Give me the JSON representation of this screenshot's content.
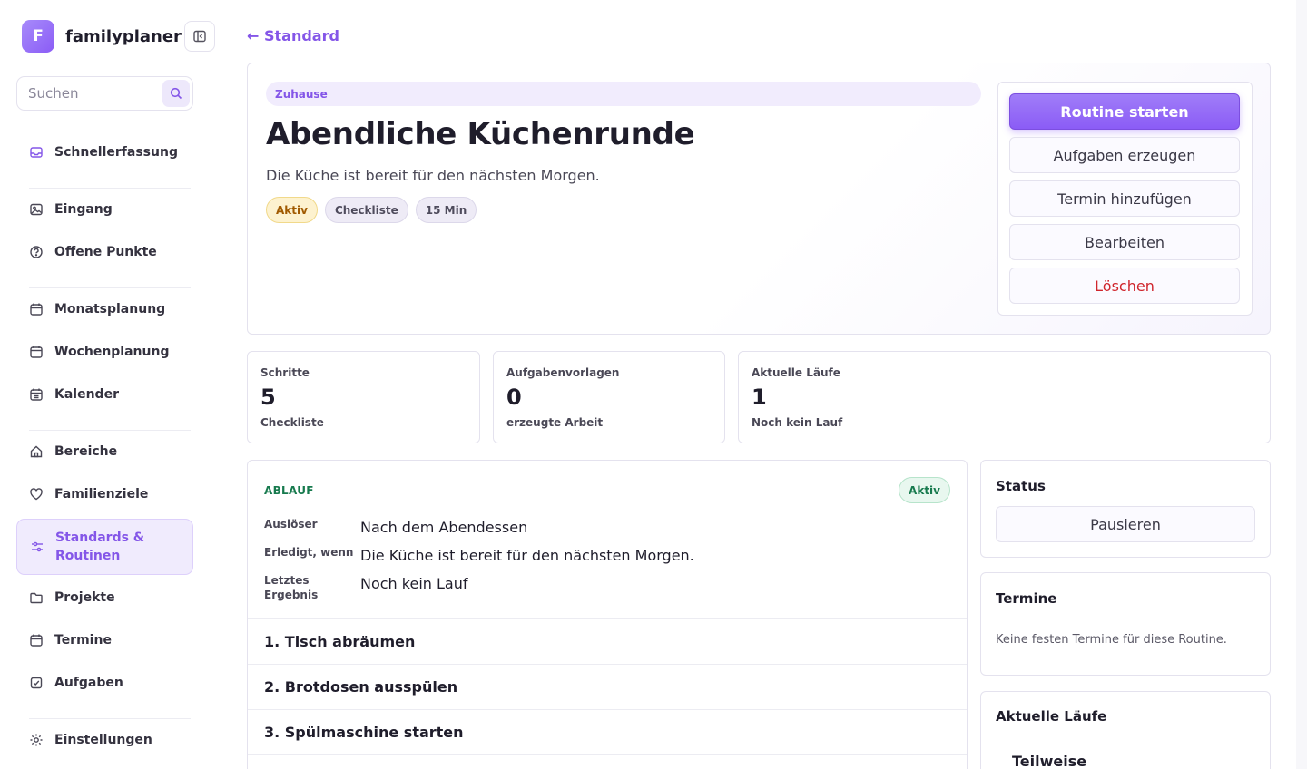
{
  "app": {
    "logo_letter": "F",
    "name": "familyplaner"
  },
  "search": {
    "placeholder": "Suchen",
    "value": ""
  },
  "sidebar": {
    "items": [
      {
        "label": "Schnellerfassung",
        "icon": "inbox-icon"
      },
      {
        "label": "Eingang",
        "icon": "image-icon"
      },
      {
        "label": "Offene Punkte",
        "icon": "help-circle-icon"
      },
      {
        "label": "Monatsplanung",
        "icon": "calendar-icon"
      },
      {
        "label": "Wochenplanung",
        "icon": "calendar-icon"
      },
      {
        "label": "Kalender",
        "icon": "calendar-grid-icon"
      },
      {
        "label": "Bereiche",
        "icon": "home-icon"
      },
      {
        "label": "Familienziele",
        "icon": "heart-icon"
      },
      {
        "label": "Standards & Routinen",
        "icon": "sliders-icon",
        "active": true
      },
      {
        "label": "Projekte",
        "icon": "folder-icon"
      },
      {
        "label": "Termine",
        "icon": "calendar-icon"
      },
      {
        "label": "Aufgaben",
        "icon": "check-square-icon"
      },
      {
        "label": "Einstellungen",
        "icon": "gear-icon"
      }
    ]
  },
  "breadcrumb": {
    "back_label": "← Standard"
  },
  "routine": {
    "area": "Zuhause",
    "title": "Abendliche Küchenrunde",
    "description": "Die Küche ist bereit für den nächsten Morgen.",
    "chips": [
      "Aktiv",
      "Checkliste",
      "15 Min"
    ]
  },
  "actions": {
    "start": "Routine starten",
    "generate_tasks": "Aufgaben erzeugen",
    "add_appointment": "Termin hinzufügen",
    "edit": "Bearbeiten",
    "delete": "Löschen"
  },
  "stats": [
    {
      "label": "Schritte",
      "value": "5",
      "sub": "Checkliste"
    },
    {
      "label": "Aufgabenvorlagen",
      "value": "0",
      "sub": "erzeugte Arbeit"
    },
    {
      "label": "Aktuelle Läufe",
      "value": "1",
      "sub": "Noch kein Lauf"
    }
  ],
  "flow": {
    "heading": "ABLAUF",
    "badge": "Aktiv",
    "trigger_label": "Auslöser",
    "trigger_value": "Nach dem Abendessen",
    "done_label": "Erledigt, wenn",
    "done_value": "Die Küche ist bereit für den nächsten Morgen.",
    "last_label_1": "Letztes",
    "last_label_2": "Ergebnis",
    "last_value": "Noch kein Lauf",
    "steps": [
      "1. Tisch abräumen",
      "2. Brotdosen ausspülen",
      "3. Spülmaschine starten"
    ]
  },
  "status_card": {
    "title": "Status",
    "button": "Pausieren"
  },
  "appointments_card": {
    "title": "Termine",
    "note": "Keine festen Termine für diese Routine."
  },
  "runs_card": {
    "title": "Aktuelle Läufe",
    "first_run": "Teilweise"
  },
  "colors": {
    "accent": "#8b5cf6",
    "danger": "#d0262d",
    "success": "#177a4e",
    "warning": "#a05a00"
  }
}
